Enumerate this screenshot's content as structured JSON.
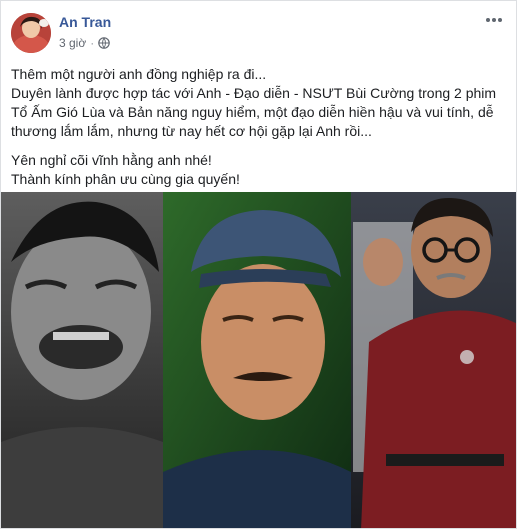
{
  "post": {
    "author": "An Tran",
    "time": "3 giờ",
    "privacy_icon": "globe-icon",
    "menu_icon": "more-options-icon",
    "lines": [
      "Thêm một người anh đồng nghiệp ra đi...",
      "Duyên lành được hợp tác với Anh - Đạo diễn - NSƯT Bùi Cường trong 2 phim",
      "Tổ Ấm Gió Lùa và Bản năng nguy hiểm, một đạo diễn hiền hậu và vui tính, dễ",
      "thương lắm lắm, nhưng từ nay hết cơ hội gặp lại Anh rồi...",
      "Yên nghỉ cõi vĩnh hằng anh nhé!",
      "Thành kính phân ưu cùng gia quyến!"
    ]
  },
  "colors": {
    "author": "#385898",
    "meta": "#616770",
    "text": "#1c1e21",
    "border": "#dddfe2"
  }
}
